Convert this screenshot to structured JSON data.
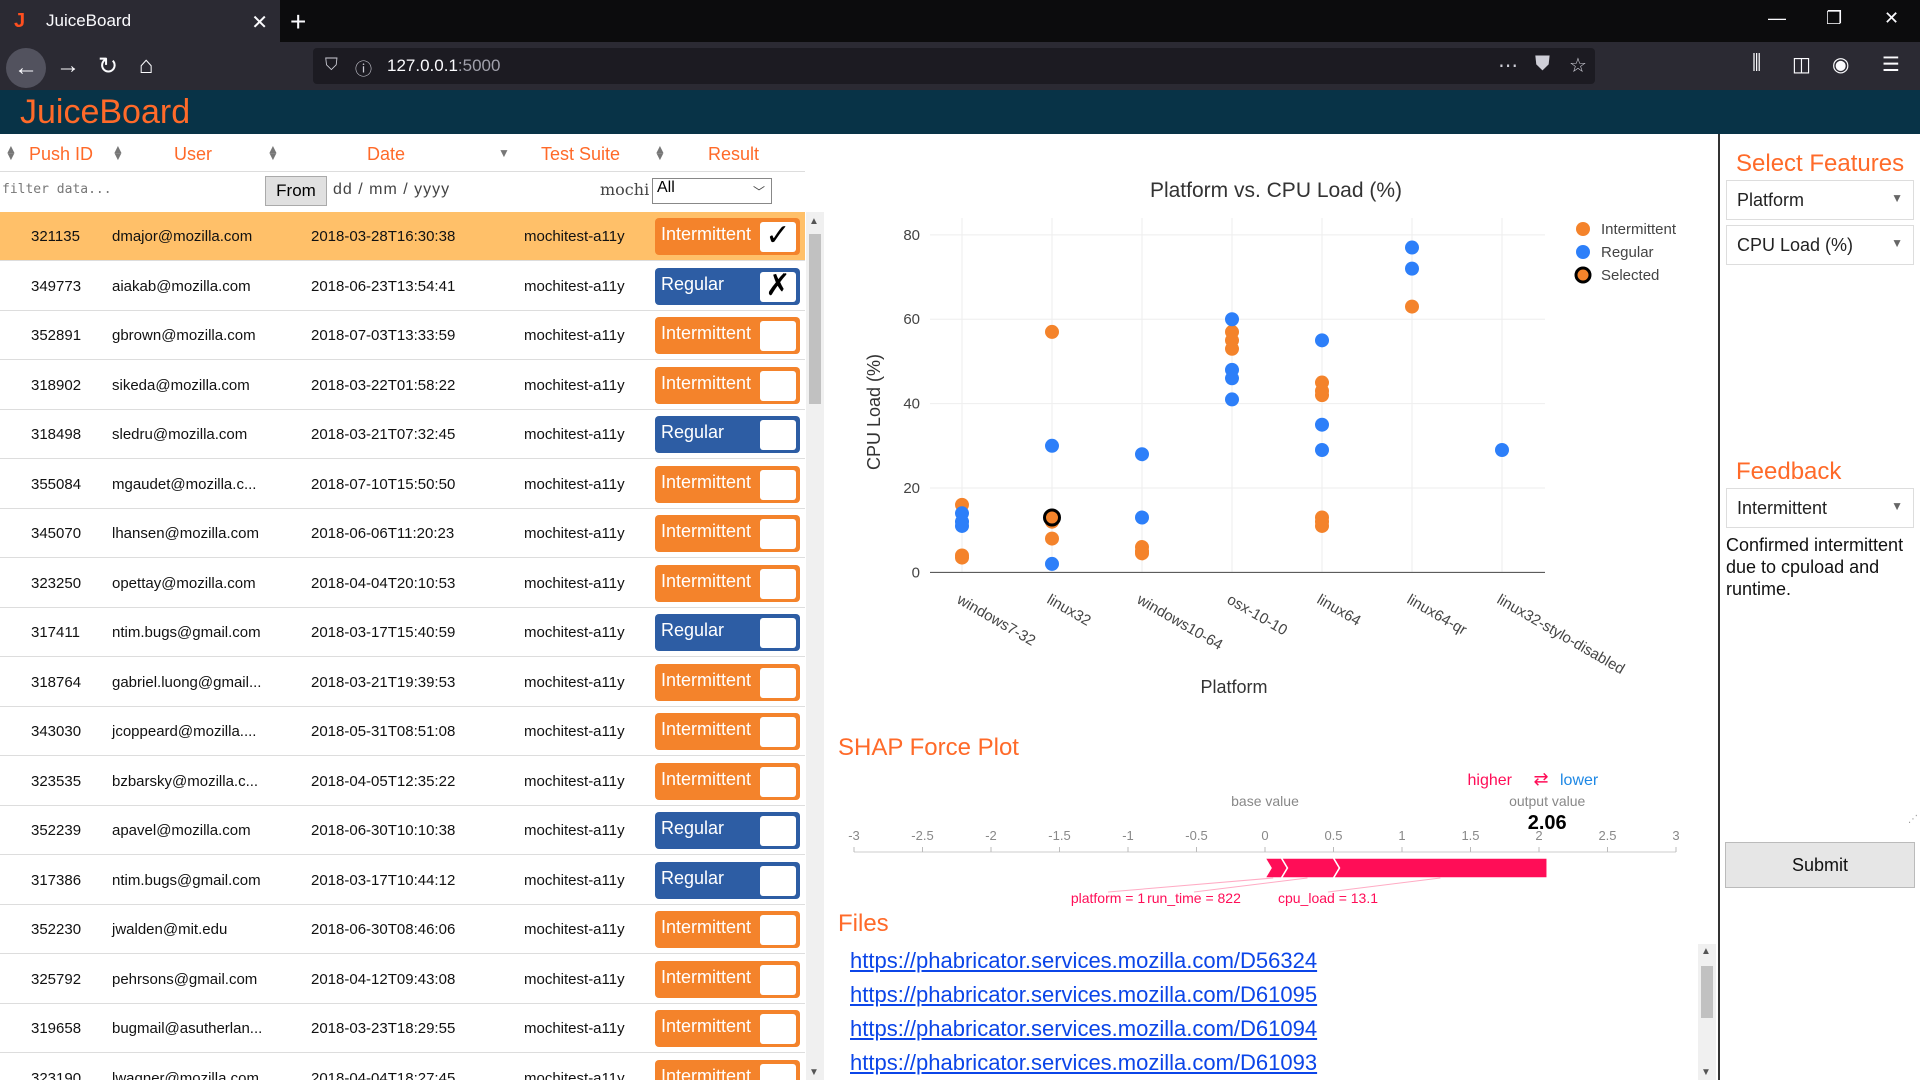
{
  "browser": {
    "tab_title": "JuiceBoard",
    "tab_favicon": "J",
    "url_host": "127.0.0.1",
    "url_port": ":5000"
  },
  "app": {
    "brand": "JuiceBoard"
  },
  "table": {
    "headers": [
      "Push ID",
      "User",
      "Date",
      "Test Suite",
      "Result"
    ],
    "filter_placeholder": "filter data...",
    "from_label": "From",
    "date_placeholder": "dd / mm / yyyy",
    "suite_filter": "mochi",
    "result_filter": "All",
    "rows": [
      {
        "push_id": "321135",
        "user": "dmajor@mozilla.com",
        "date": "2018-03-28T16:30:38",
        "suite": "mochitest-a11y",
        "result": "Intermittent",
        "mark": "✓",
        "selected": true
      },
      {
        "push_id": "349773",
        "user": "aiakab@mozilla.com",
        "date": "2018-06-23T13:54:41",
        "suite": "mochitest-a11y",
        "result": "Regular",
        "mark": "✗"
      },
      {
        "push_id": "352891",
        "user": "gbrown@mozilla.com",
        "date": "2018-07-03T13:33:59",
        "suite": "mochitest-a11y",
        "result": "Intermittent",
        "mark": ""
      },
      {
        "push_id": "318902",
        "user": "sikeda@mozilla.com",
        "date": "2018-03-22T01:58:22",
        "suite": "mochitest-a11y",
        "result": "Intermittent",
        "mark": ""
      },
      {
        "push_id": "318498",
        "user": "sledru@mozilla.com",
        "date": "2018-03-21T07:32:45",
        "suite": "mochitest-a11y",
        "result": "Regular",
        "mark": ""
      },
      {
        "push_id": "355084",
        "user": "mgaudet@mozilla.c...",
        "date": "2018-07-10T15:50:50",
        "suite": "mochitest-a11y",
        "result": "Intermittent",
        "mark": ""
      },
      {
        "push_id": "345070",
        "user": "lhansen@mozilla.com",
        "date": "2018-06-06T11:20:23",
        "suite": "mochitest-a11y",
        "result": "Intermittent",
        "mark": ""
      },
      {
        "push_id": "323250",
        "user": "opettay@mozilla.com",
        "date": "2018-04-04T20:10:53",
        "suite": "mochitest-a11y",
        "result": "Intermittent",
        "mark": ""
      },
      {
        "push_id": "317411",
        "user": "ntim.bugs@gmail.com",
        "date": "2018-03-17T15:40:59",
        "suite": "mochitest-a11y",
        "result": "Regular",
        "mark": ""
      },
      {
        "push_id": "318764",
        "user": "gabriel.luong@gmail...",
        "date": "2018-03-21T19:39:53",
        "suite": "mochitest-a11y",
        "result": "Intermittent",
        "mark": ""
      },
      {
        "push_id": "343030",
        "user": "jcoppeard@mozilla....",
        "date": "2018-05-31T08:51:08",
        "suite": "mochitest-a11y",
        "result": "Intermittent",
        "mark": ""
      },
      {
        "push_id": "323535",
        "user": "bzbarsky@mozilla.c...",
        "date": "2018-04-05T12:35:22",
        "suite": "mochitest-a11y",
        "result": "Intermittent",
        "mark": ""
      },
      {
        "push_id": "352239",
        "user": "apavel@mozilla.com",
        "date": "2018-06-30T10:10:38",
        "suite": "mochitest-a11y",
        "result": "Regular",
        "mark": ""
      },
      {
        "push_id": "317386",
        "user": "ntim.bugs@gmail.com",
        "date": "2018-03-17T10:44:12",
        "suite": "mochitest-a11y",
        "result": "Regular",
        "mark": ""
      },
      {
        "push_id": "352230",
        "user": "jwalden@mit.edu",
        "date": "2018-06-30T08:46:06",
        "suite": "mochitest-a11y",
        "result": "Intermittent",
        "mark": ""
      },
      {
        "push_id": "325792",
        "user": "pehrsons@gmail.com",
        "date": "2018-04-12T09:43:08",
        "suite": "mochitest-a11y",
        "result": "Intermittent",
        "mark": ""
      },
      {
        "push_id": "319658",
        "user": "bugmail@asutherlan...",
        "date": "2018-03-23T18:29:55",
        "suite": "mochitest-a11y",
        "result": "Intermittent",
        "mark": ""
      },
      {
        "push_id": "323190",
        "user": "lwagner@mozilla.com",
        "date": "2018-04-04T18:27:45",
        "suite": "mochitest-a11y",
        "result": "Intermittent",
        "mark": ""
      }
    ]
  },
  "colors": {
    "intermittent": "#f4832b",
    "regular": "#2d7ff9",
    "accent": "#ff6a29",
    "header_bg": "#083347"
  },
  "chart_data": {
    "type": "scatter",
    "title": "Platform vs. CPU Load (%)",
    "xlabel": "Platform",
    "ylabel": "CPU Load (%)",
    "categories": [
      "windows7-32",
      "linux32",
      "windows10-64",
      "osx-10-10",
      "linux64",
      "linux64-qr",
      "linux32-stylo-disabled"
    ],
    "ylim": [
      -3,
      84
    ],
    "yticks": [
      0,
      20,
      40,
      60,
      80
    ],
    "legend_position": "top-right",
    "series": [
      {
        "name": "Intermittent",
        "color": "#f4832b",
        "points": [
          [
            0,
            16
          ],
          [
            0,
            4
          ],
          [
            0,
            3.5
          ],
          [
            1,
            57
          ],
          [
            1,
            8
          ],
          [
            1,
            12
          ],
          [
            2,
            5
          ],
          [
            2,
            6
          ],
          [
            2,
            4.5
          ],
          [
            3,
            57
          ],
          [
            3,
            55
          ],
          [
            3,
            53
          ],
          [
            4,
            45
          ],
          [
            4,
            43
          ],
          [
            4,
            42
          ],
          [
            4,
            13
          ],
          [
            4,
            12
          ],
          [
            4,
            11
          ],
          [
            5,
            63
          ]
        ]
      },
      {
        "name": "Regular",
        "color": "#2d7ff9",
        "points": [
          [
            0,
            14
          ],
          [
            0,
            12
          ],
          [
            0,
            11
          ],
          [
            1,
            30
          ],
          [
            1,
            2
          ],
          [
            2,
            28
          ],
          [
            2,
            13
          ],
          [
            3,
            60
          ],
          [
            3,
            48
          ],
          [
            3,
            46
          ],
          [
            3,
            41
          ],
          [
            4,
            55
          ],
          [
            4,
            35
          ],
          [
            4,
            29
          ],
          [
            5,
            77
          ],
          [
            5,
            72
          ],
          [
            6,
            29
          ]
        ]
      },
      {
        "name": "Selected",
        "color": "#f4832b",
        "points": [
          [
            1,
            13
          ]
        ]
      }
    ]
  },
  "shap": {
    "title": "SHAP Force Plot",
    "higher": "higher",
    "arrows": "⇄",
    "lower": "lower",
    "base_label": "base value",
    "output_label": "output value",
    "output_value": "2.06",
    "axis_min": -3,
    "axis_max": 3,
    "ticks": [
      "-3",
      "-2.5",
      "-2",
      "-1.5",
      "-1",
      "-0.5",
      "0",
      "0.5",
      "1",
      "1.5",
      "2",
      "2.5",
      "3"
    ],
    "base_value": 0,
    "segments": [
      {
        "label": "platform = 1",
        "from": 0,
        "to": 0.12
      },
      {
        "label": "run_time = 822",
        "from": 0.12,
        "to": 0.5
      },
      {
        "label": "cpu_load = 13.1",
        "from": 0.5,
        "to": 2.06
      }
    ],
    "color": "#ff0d57"
  },
  "files": {
    "title": "Files",
    "links": [
      "https://phabricator.services.mozilla.com/D56324",
      "https://phabricator.services.mozilla.com/D61095",
      "https://phabricator.services.mozilla.com/D61094",
      "https://phabricator.services.mozilla.com/D61093"
    ]
  },
  "features": {
    "title": "Select Features",
    "x_feature": "Platform",
    "y_feature": "CPU Load (%)"
  },
  "feedback": {
    "title": "Feedback",
    "value": "Intermittent",
    "text": "Confirmed intermittent due to cpuload and runtime.",
    "submit_label": "Submit"
  }
}
